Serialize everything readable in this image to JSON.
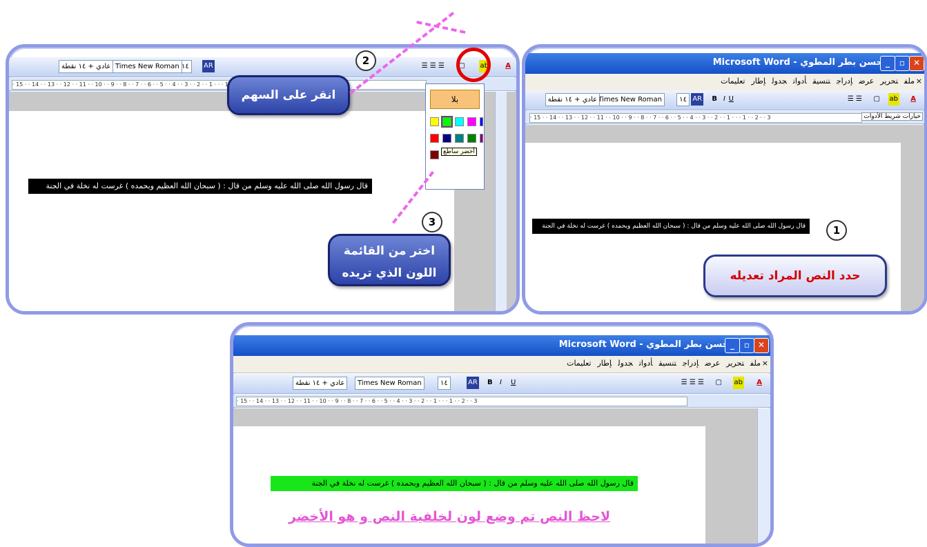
{
  "colors": {
    "accent": "#8f9be6",
    "selection": "#000000",
    "highlight": "#19e619",
    "callout_text": "#d30000",
    "pink_caption": "#e457d6"
  },
  "word": {
    "title": "حسن بطر المطوي - Microsoft Word",
    "menu": [
      "ملف",
      "تحرير",
      "عرض",
      "إدراج",
      "تنسيق",
      "أدوات",
      "جدول",
      "إطار",
      "تعليمات"
    ],
    "menu_close": "×",
    "style": "عادي + ١٤ نقطة",
    "font": "Times New Roman",
    "size": "١٤",
    "ar_button": "AR",
    "bold": "B",
    "italic": "I",
    "underline": "U",
    "ruler_numbers": "· 15 · · 14 · · 13 · · 12 · · 11 · · 10 · · 9 · · 8 · · 7 · · 6 · · 5 · · 4 · · 3 · · 2 · · 1 · · · 1 · · 2 · · 3",
    "highlight_icon_label": "ab",
    "font_color_label": "A",
    "toolbar_tab_label": "خيارات شريط الأدوات"
  },
  "steps": {
    "step1": {
      "num": "1",
      "text": "حدد النص المراد تعديله"
    },
    "step2": {
      "num": "2",
      "text": "انقر على السهم"
    },
    "step3": {
      "num": "3",
      "text": "اختر من القائمة اللون الذي تريده"
    }
  },
  "palette": {
    "none_label": "بلا",
    "colors": [
      "#ffff00",
      "#00ff00",
      "#00ffff",
      "#ff00ff",
      "#0000ff",
      "#ff0000",
      "#000080",
      "#008080",
      "#008000",
      "#800080",
      "#800000"
    ],
    "selected_tooltip": "أخضر ساطع"
  },
  "document": {
    "hadith": "قال رسول الله صلى الله عليه وسلم من قال : ( سبحان الله العظيم وبحمده ) غرست له نخلة في الجنة"
  },
  "caption": "لاحظ النص تم وضع لون لخلفية النص و هو الأخضر"
}
